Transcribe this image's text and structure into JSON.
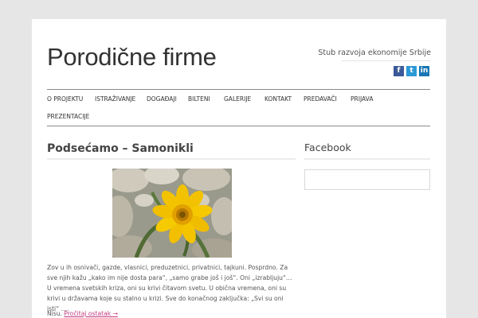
{
  "site": {
    "title": "Porodične firme",
    "tagline": "Stub razvoja ekonomije Srbije"
  },
  "social": [
    {
      "icon": "facebook-icon",
      "glyph": "f",
      "color": "#3b5998"
    },
    {
      "icon": "twitter-icon",
      "glyph": "t",
      "color": "#2c9ad6"
    },
    {
      "icon": "linkedin-icon",
      "glyph": "in",
      "color": "#1877b5"
    }
  ],
  "nav": {
    "items": [
      {
        "label": "O projektu"
      },
      {
        "label": "Istraživanje"
      },
      {
        "label": "Događaji"
      },
      {
        "label": "Bilteni"
      },
      {
        "label": "Galerije"
      },
      {
        "label": "Kontakt"
      },
      {
        "label": "Predavači"
      },
      {
        "label": "Prijava"
      },
      {
        "label": "Prezentacije"
      }
    ]
  },
  "post": {
    "title": "Podsećamo – Samonikli",
    "excerpt": "Zov u ih osnivači, gazde, vlasnici, preduzetnici, privatnici, tajkuni. Posprdno. Za sve njih kažu „kako im nije dosta para“, „samo grabe još i još“. Oni „izrabljuju“… U vremena svetskih kriza, oni su krivi čitavom svetu. U obična vremena, oni su krivi u državama koje su stalno u krizi. Sve do konačnog zaključka: „Svi su oni isti“ ….",
    "more_prefix": "Nisu.",
    "more_link": "Pročitaj ostatak →"
  },
  "sidebar": {
    "widget_title": "Facebook"
  },
  "colors": {
    "accent_link": "#c23a7d",
    "background": "#e6e6e6"
  }
}
